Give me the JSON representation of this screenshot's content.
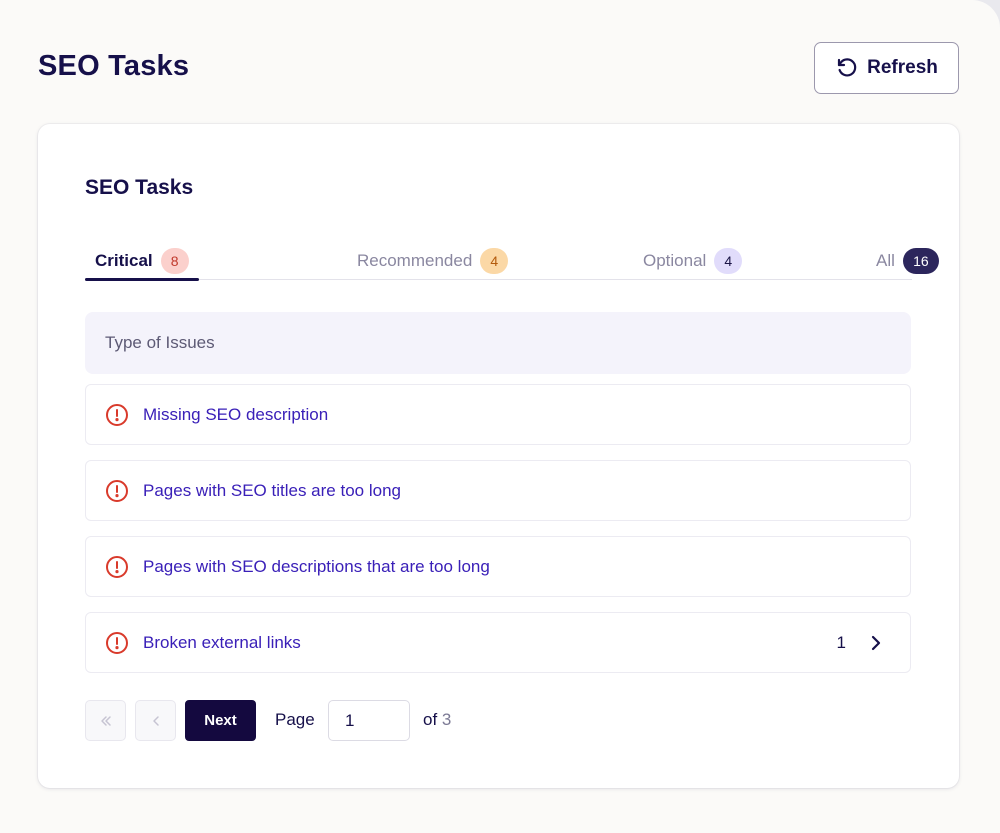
{
  "header": {
    "title": "SEO Tasks",
    "refresh_label": "Refresh"
  },
  "card": {
    "title": "SEO Tasks",
    "tabs": [
      {
        "label": "Critical",
        "count": "8",
        "active": true
      },
      {
        "label": "Recommended",
        "count": "4",
        "active": false
      },
      {
        "label": "Optional",
        "count": "4",
        "active": false
      },
      {
        "label": "All",
        "count": "16",
        "active": false
      }
    ],
    "table_header": "Type of Issues",
    "rows": [
      {
        "label": "Missing SEO description"
      },
      {
        "label": "Pages with SEO titles are too long"
      },
      {
        "label": "Pages with SEO descriptions that are too long"
      },
      {
        "label": "Broken external links",
        "count": "1"
      }
    ]
  },
  "pagination": {
    "next_label": "Next",
    "page_label": "Page",
    "current_page": "1",
    "of_label": "of",
    "total_pages": "3"
  },
  "colors": {
    "primary": "#14093f",
    "link": "#3a20b8",
    "critical": "#d93a2b"
  }
}
